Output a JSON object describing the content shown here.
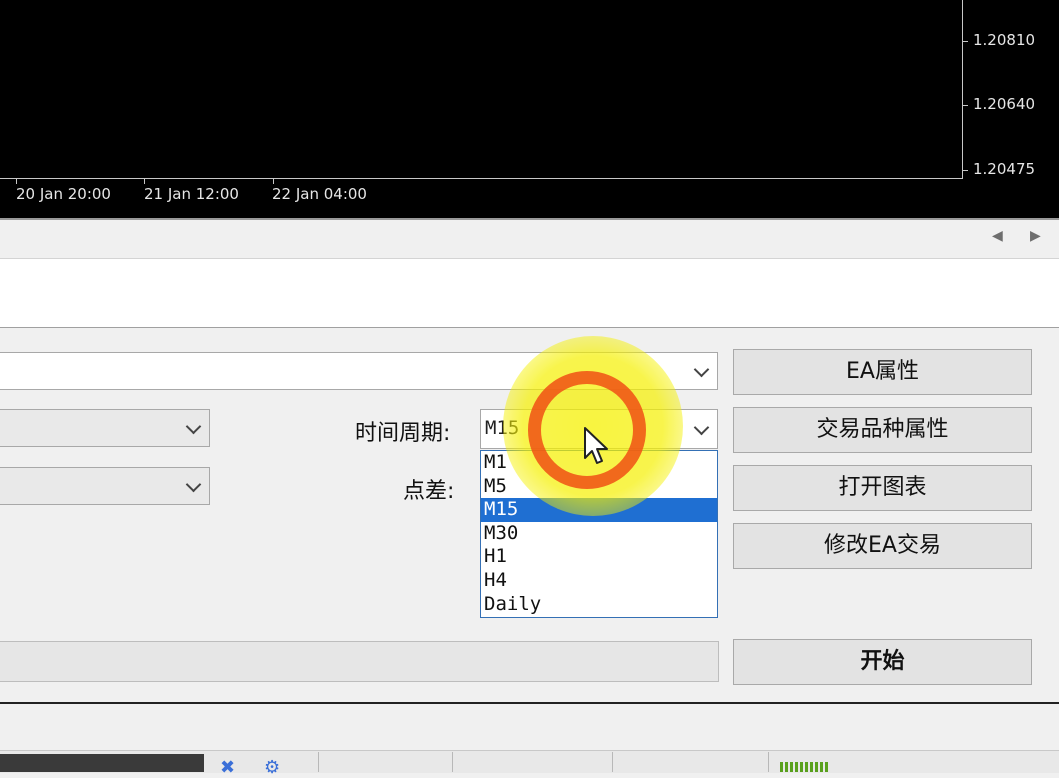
{
  "chart": {
    "price_labels": [
      "1.20810",
      "1.20640",
      "1.20475"
    ],
    "time_labels": [
      "20 Jan 20:00",
      "21 Jan 12:00",
      "22 Jan 04:00"
    ],
    "colors": {
      "background": "#000000",
      "axis_text": "#e6e6e6"
    }
  },
  "scrollbar": {
    "left_arrow": "◀",
    "right_arrow": "▶"
  },
  "settings": {
    "period_label": "时间周期:",
    "spread_label": "点差:",
    "period_combo_value": "M15",
    "period_options": [
      "M1",
      "M5",
      "M15",
      "M30",
      "H1",
      "H4",
      "Daily"
    ],
    "period_selected": "M15"
  },
  "buttons": {
    "ea_properties": "EA属性",
    "symbol_properties": "交易品种属性",
    "open_chart": "打开图表",
    "modify_ea": "修改EA交易",
    "start": "开始"
  },
  "taskbar": {
    "icons": [
      "pin-icon",
      "gear-icon"
    ]
  }
}
